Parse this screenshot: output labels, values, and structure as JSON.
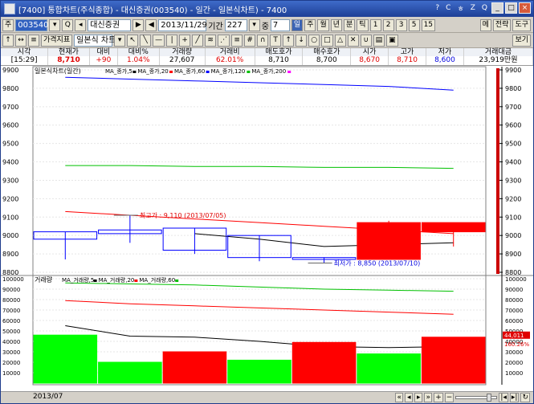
{
  "window": {
    "title": "[7400] 통합차트(주식종합) - 대신증권(003540) - 일간 - 일본식차트) - 7400",
    "title_icons": [
      "?",
      "C",
      "ㅎ",
      "Z",
      "Q"
    ]
  },
  "toolbar1": {
    "market_label": "주",
    "code": "003540",
    "stock_name": "대신증권",
    "date": "2013/11/29",
    "period_label": "기간",
    "period_value": "227",
    "count_label": "중",
    "count_value": "7",
    "interval_buttons": [
      "일",
      "주",
      "월",
      "년",
      "분",
      "틱",
      "1",
      "2",
      "3",
      "5",
      "15"
    ],
    "right_buttons": [
      "메",
      "전략",
      "도구",
      "보기"
    ]
  },
  "toolbar2": {
    "price_index_button": "가격지표",
    "chart_type": "일본식 차트"
  },
  "quote": {
    "headers": [
      "시각",
      "현재가",
      "대비",
      "대비%",
      "거래량",
      "거래비",
      "매도호가",
      "매수호가",
      "시가",
      "고가",
      "저가",
      "거래대금"
    ],
    "values": [
      "[15:29]",
      "8,710",
      "+90",
      "1.04%",
      "27,607",
      "62.01%",
      "8,710",
      "8,700",
      "8,670",
      "8,710",
      "8,600",
      "23,919만원"
    ]
  },
  "status": {
    "date_label": "2013/07"
  },
  "chart_data": [
    {
      "type": "candlestick",
      "title": "일본식차트(일간)",
      "legend": [
        "MA_종가,5",
        "MA_종가,20",
        "MA_종가,60",
        "MA_종가,120",
        "MA_종가,200"
      ],
      "colors": {
        "up": "#ff0000",
        "down": "#0000ff",
        "ma5": "#000000",
        "ma20": "#ff0000",
        "ma60": "#0000ff",
        "ma120": "#00c000",
        "ma200": "#ff00ff"
      },
      "y_axis": {
        "min": 8800,
        "max": 9900,
        "ticks": [
          8800,
          8900,
          9000,
          9100,
          9200,
          9300,
          9400,
          9500,
          9600,
          9700,
          9800,
          9900
        ]
      },
      "candles": [
        {
          "open": 9020,
          "high": 9020,
          "low": 8870,
          "close": 8980
        },
        {
          "open": 9030,
          "high": 9110,
          "low": 8960,
          "close": 9010
        },
        {
          "open": 9040,
          "high": 9040,
          "low": 8900,
          "close": 8920
        },
        {
          "open": 9000,
          "high": 9000,
          "low": 8860,
          "close": 8880
        },
        {
          "open": 8880,
          "high": 8880,
          "low": 8850,
          "close": 8870
        },
        {
          "open": 8870,
          "high": 9080,
          "low": 8870,
          "close": 9070
        },
        {
          "open": 9020,
          "high": 9070,
          "low": 8940,
          "close": 9070
        }
      ],
      "ma_series": [
        {
          "name": "MA_종가,5",
          "values": [
            null,
            null,
            9010,
            8980,
            8940,
            8950,
            8960
          ]
        },
        {
          "name": "MA_종가,20",
          "values": [
            9130,
            9110,
            9090,
            9070,
            9050,
            9030,
            9010
          ]
        },
        {
          "name": "MA_종가,60",
          "values": [
            9860,
            9850,
            9840,
            9830,
            9820,
            9810,
            9790
          ]
        },
        {
          "name": "MA_종가,120",
          "values": [
            9380,
            9380,
            9375,
            9375,
            9370,
            9370,
            9365
          ]
        }
      ],
      "annotations": [
        {
          "label": "최고가 : 9,110 (2013/07/05)",
          "value": 9110,
          "candle": 1
        },
        {
          "label": "최저가 : 8,850 (2013/07/10)",
          "value": 8850,
          "candle": 4
        }
      ],
      "last_price": "8,710"
    },
    {
      "type": "bar",
      "title": "거래량",
      "legend": [
        "MA_거래량,5",
        "MA_거래량,20",
        "MA_거래량,60"
      ],
      "colors": {
        "up": "#ff0000",
        "down": "#00ff00",
        "ma5": "#000000",
        "ma20": "#ff0000",
        "ma60": "#00c000"
      },
      "y_axis": {
        "min": 0,
        "max": 100000,
        "ticks": [
          10000,
          20000,
          30000,
          40000,
          50000,
          60000,
          70000,
          80000,
          90000,
          100000
        ]
      },
      "values": [
        46000,
        20000,
        30000,
        22000,
        39000,
        28000,
        44011
      ],
      "bar_colors": [
        "down",
        "down",
        "up",
        "down",
        "up",
        "down",
        "up"
      ],
      "ma_series": [
        {
          "name": "MA_거래량,5",
          "values": [
            55000,
            45000,
            44000,
            40000,
            35000,
            34000,
            35000
          ]
        },
        {
          "name": "MA_거래량,20",
          "values": [
            79000,
            76000,
            74000,
            72000,
            70000,
            68000,
            66000
          ]
        },
        {
          "name": "MA_거래량,60",
          "values": [
            96000,
            95000,
            94000,
            92000,
            90000,
            89000,
            88000
          ]
        }
      ],
      "last_value": "44,011",
      "last_ratio": "160.26%"
    }
  ]
}
